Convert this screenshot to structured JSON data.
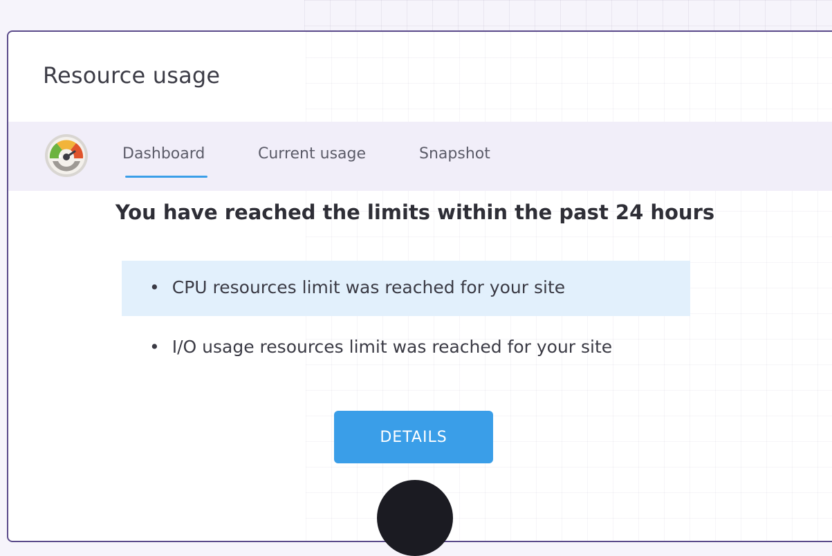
{
  "panel": {
    "title": "Resource usage"
  },
  "tabs": [
    {
      "label": "Dashboard",
      "active": true
    },
    {
      "label": "Current usage",
      "active": false
    },
    {
      "label": "Snapshot",
      "active": false
    }
  ],
  "logo_icon": "gauge-icon",
  "alert": {
    "heading": "You have reached the limits within the past 24 hours",
    "bullet": "•",
    "items": [
      "CPU resources limit was reached for your site",
      "I/O usage resources limit was reached for your site"
    ]
  },
  "details_button": {
    "label": "DETAILS"
  },
  "colors": {
    "accent": "#3a9ee8",
    "highlight": "#e2f0fc",
    "tabbar": "#f1eef9",
    "panel_border": "#5a4a8a"
  }
}
